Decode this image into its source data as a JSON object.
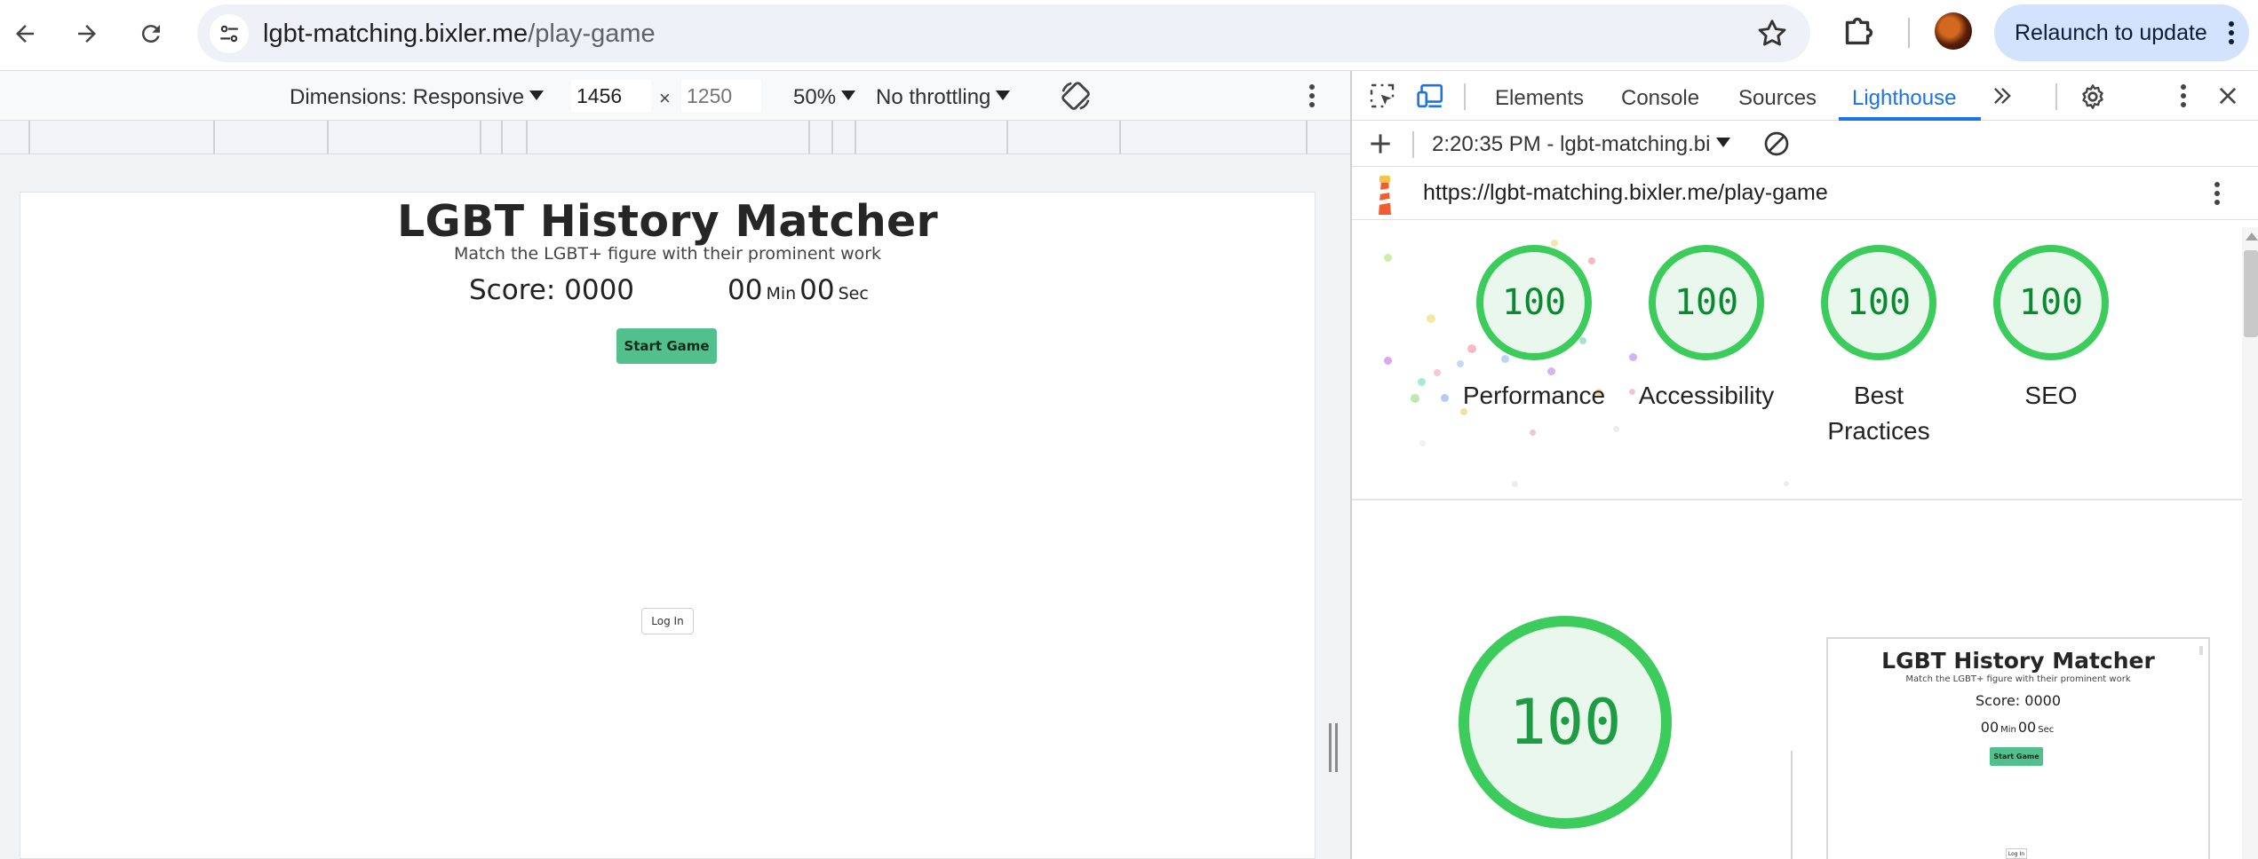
{
  "browser": {
    "url_host": "lgbt-matching.bixler.me",
    "url_path": "/play-game",
    "relaunch_label": "Relaunch to update"
  },
  "device_toolbar": {
    "dimensions_label": "Dimensions: Responsive",
    "width_value": "1456",
    "height_placeholder": "1250",
    "times_sign": "×",
    "zoom_label": "50%",
    "throttling_label": "No throttling"
  },
  "page": {
    "title": "LGBT History Matcher",
    "subtitle": "Match the LGBT+ figure with their prominent work",
    "score_text": "Score: 0000",
    "timer_minutes": "00",
    "timer_min_label": "Min",
    "timer_seconds": "00",
    "timer_sec_label": "Sec",
    "start_button": "Start Game",
    "login_button": "Log In"
  },
  "devtools": {
    "tabs": [
      "Elements",
      "Console",
      "Sources",
      "Lighthouse"
    ],
    "active_tab": "Lighthouse",
    "report_select": "2:20:35 PM - lgbt-matching.bi",
    "report_url": "https://lgbt-matching.bixler.me/play-game",
    "scores": [
      {
        "label": "Performance",
        "value": "100"
      },
      {
        "label": "Accessibility",
        "value": "100"
      },
      {
        "label": "Best Practices",
        "label_line1": "Best",
        "label_line2": "Practices",
        "value": "100"
      },
      {
        "label": "SEO",
        "value": "100"
      }
    ],
    "main_score": "100",
    "thumbnail": {
      "title": "LGBT History Matcher",
      "subtitle": "Match the LGBT+ figure with their prominent work",
      "score_text": "Score: 0000",
      "timer_minutes": "00",
      "timer_min_label": "Min",
      "timer_seconds": "00",
      "timer_sec_label": "Sec",
      "start_button": "Start Game",
      "login_button": "Log In"
    },
    "colors": {
      "pass": "#3ccc5c",
      "pass_text": "#0a8a30",
      "active_tab": "#1a73e8"
    }
  }
}
